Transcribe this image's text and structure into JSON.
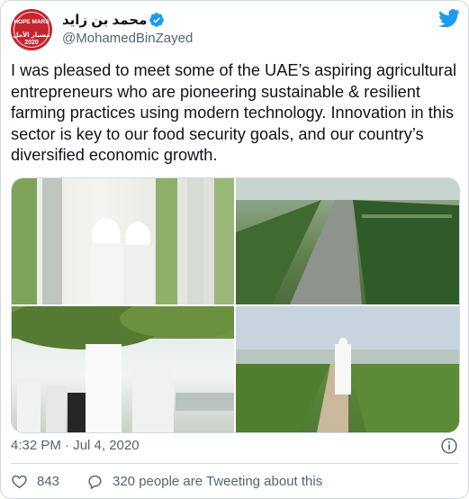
{
  "author": {
    "display_name": "محمد بن زايد",
    "handle": "@MohamedBinZayed",
    "avatar_lines": [
      "HOPE MARS",
      "مسبار الأمل 2020"
    ],
    "verified": true
  },
  "tweet": {
    "text": "I was pleased to meet some of the UAE’s aspiring agricultural entrepreneurs who are pioneering sustainable & resilient farming practices using modern technology. Innovation in this sector is key to our food security goals, and our country’s diversified economic growth."
  },
  "media": {
    "photos": [
      "photo-1",
      "photo-2",
      "photo-3",
      "photo-4"
    ]
  },
  "meta": {
    "timestamp": "4:32 PM · Jul 4, 2020"
  },
  "actions": {
    "like_count": "843",
    "reply_text": "320 people are Tweeting about this"
  },
  "colors": {
    "twitter_blue": "#1d9bf0",
    "text_primary": "#0f1419",
    "text_secondary": "#536471",
    "border": "#cfd9de"
  },
  "icons": [
    "verified-badge-icon",
    "twitter-bird-icon",
    "info-icon",
    "heart-icon",
    "comment-bubble-icon"
  ]
}
